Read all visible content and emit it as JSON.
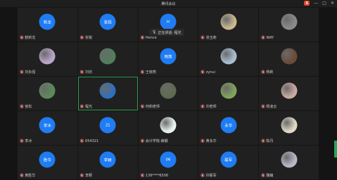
{
  "window": {
    "title": "腾讯会议"
  },
  "speaking": {
    "text": "正在讲话: 程光"
  },
  "tiles": [
    {
      "avatar": "新龙",
      "name": "鹤新龙",
      "type": "blue"
    },
    {
      "avatar": "张锐",
      "name": "张锐",
      "type": "blue"
    },
    {
      "avatar": "H",
      "name": "Hence",
      "type": "blue"
    },
    {
      "avatar": "",
      "name": "张玉莉",
      "type": "photo",
      "photo_color": "#c9b78f"
    },
    {
      "avatar": "",
      "name": "WAY",
      "type": "photo",
      "photo_color": "#8a8a8a"
    },
    {
      "avatar": "",
      "name": "刘永强",
      "type": "photo",
      "photo_color": "#b9a5c8"
    },
    {
      "avatar": "",
      "name": "刘坊",
      "type": "photo",
      "photo_color": "#4f7f5b"
    },
    {
      "avatar": "晓燕",
      "name": "王晓燕",
      "type": "blue"
    },
    {
      "avatar": "",
      "name": "zynui",
      "type": "photo",
      "photo_color": "#a9bdd0"
    },
    {
      "avatar": "",
      "name": "杨莉",
      "type": "photo",
      "photo_color": "#6a4a3a"
    },
    {
      "avatar": "",
      "name": "宫松",
      "type": "photo",
      "photo_color": "#5b8a5a"
    },
    {
      "avatar": "",
      "name": "程光",
      "type": "photo",
      "photo_color": "#2e6fc0",
      "active": true
    },
    {
      "avatar": "",
      "name": "何莉老师",
      "type": "photo",
      "photo_color": "#5d6b4e"
    },
    {
      "avatar": "",
      "name": "刘老师",
      "type": "photo",
      "photo_color": "#7fa35a"
    },
    {
      "avatar": "",
      "name": "杨凌云",
      "type": "photo",
      "photo_color": "#c9a9a0"
    },
    {
      "avatar": "李冰",
      "name": "李冰",
      "type": "blue"
    },
    {
      "avatar": "21",
      "name": "654321",
      "type": "blue"
    },
    {
      "avatar": "",
      "name": "会计学院-薛娜",
      "type": "photo",
      "photo_color": "#e8f4f2"
    },
    {
      "avatar": "永华",
      "name": "黄永华",
      "type": "blue"
    },
    {
      "avatar": "",
      "name": "陈丹",
      "type": "photo",
      "photo_color": "#e0d9c8"
    },
    {
      "avatar": "胜华",
      "name": "黄胜华",
      "type": "blue"
    },
    {
      "avatar": "李颖",
      "name": "李颖",
      "type": "blue"
    },
    {
      "avatar": "06",
      "name": "136****6506",
      "type": "blue"
    },
    {
      "avatar": "联军",
      "name": "孙联军",
      "type": "blue"
    },
    {
      "avatar": "",
      "name": "魏巍",
      "type": "photo",
      "photo_color": "#b7b7c9"
    }
  ]
}
